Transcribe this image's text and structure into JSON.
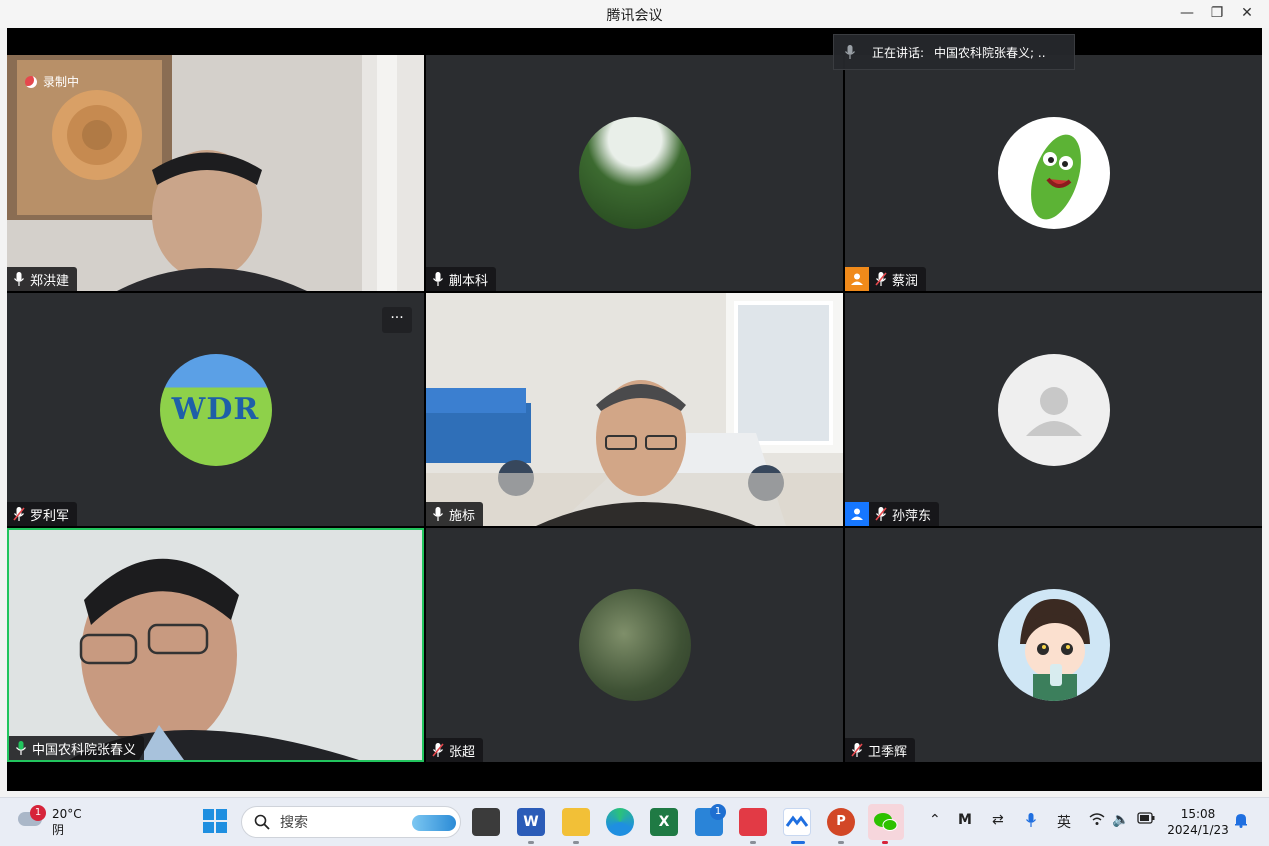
{
  "window": {
    "title": "腾讯会议"
  },
  "speaking": {
    "label": "正在讲话:",
    "name": "中国农科院张春义; .."
  },
  "recording": {
    "label": "录制中"
  },
  "tiles": [
    {
      "name": "郑洪建",
      "mic": "on"
    },
    {
      "name": "蒯本科",
      "mic": "on"
    },
    {
      "name": "蔡润",
      "mic": "muted",
      "badge": "orange"
    },
    {
      "name": "罗利军",
      "mic": "muted"
    },
    {
      "name": "施标",
      "mic": "on"
    },
    {
      "name": "孙萍东",
      "mic": "muted",
      "badge": "blue"
    },
    {
      "name": "中国农科院张春义",
      "mic": "active"
    },
    {
      "name": "张超",
      "mic": "muted"
    },
    {
      "name": "卫季辉",
      "mic": "muted"
    }
  ],
  "avatar_text": {
    "wdr": "WDR"
  },
  "taskbar": {
    "weather_temp": "20°C",
    "weather_desc": "阴",
    "weather_badge": "1",
    "search_placeholder": "搜索",
    "mail_badge": "1",
    "ime": "英",
    "time": "15:08",
    "date": "2024/1/23"
  },
  "colors": {
    "active_border": "#22c55e",
    "tile_bg": "#2b2d30",
    "muted_mic": "#e5484d"
  }
}
